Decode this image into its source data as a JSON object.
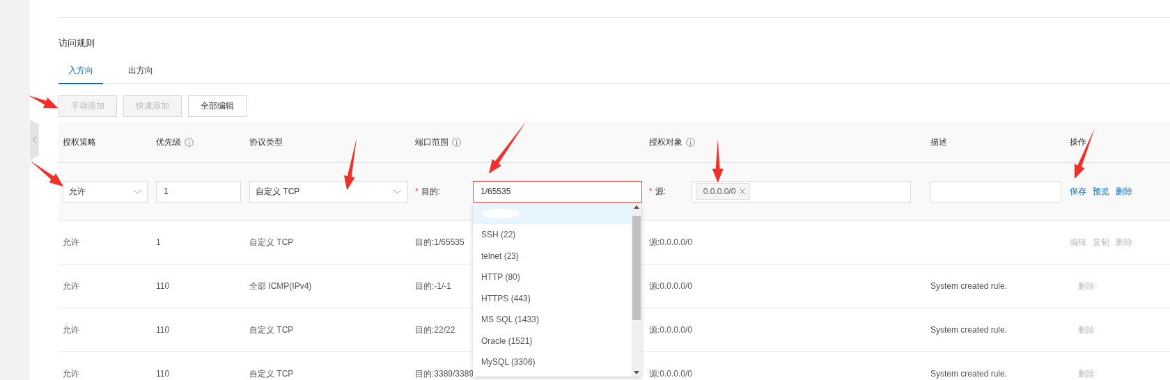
{
  "section_title": "访问规则",
  "tabs": [
    {
      "label": "入方向",
      "selected": true
    },
    {
      "label": "出方向",
      "selected": false
    }
  ],
  "toolbar": [
    {
      "label": "手动添加",
      "disabled": true
    },
    {
      "label": "快速添加",
      "disabled": true
    },
    {
      "label": "全部编辑",
      "disabled": false
    }
  ],
  "table": {
    "columns": [
      {
        "label": "授权策略",
        "info": false
      },
      {
        "label": "优先级",
        "info": true
      },
      {
        "label": "协议类型",
        "info": false
      },
      {
        "label": "端口范围",
        "info": true
      },
      {
        "label": "授权对象",
        "info": true
      },
      {
        "label": "描述",
        "info": false
      },
      {
        "label": "操作",
        "info": false
      }
    ],
    "edit_row": {
      "policy": "允许",
      "priority": "1",
      "protocol": "自定义 TCP",
      "required_mark": "*",
      "port_label": "目的:",
      "port_value": "1/65535",
      "invalid": true,
      "source_label": "源:",
      "source_tags": [
        "0.0.0.0/0"
      ],
      "actions": [
        {
          "label": "保存",
          "disabled": false
        },
        {
          "label": "预览",
          "disabled": false
        },
        {
          "label": "删除",
          "disabled": false
        }
      ]
    },
    "port_dropdown": [
      {
        "kind": "redacted",
        "selected": true
      },
      {
        "kind": "option",
        "label": "SSH (22)",
        "selected": false
      },
      {
        "kind": "option",
        "label": "telnet (23)",
        "selected": false
      },
      {
        "kind": "option",
        "label": "HTTP (80)",
        "selected": false
      },
      {
        "kind": "option",
        "label": "HTTPS (443)",
        "selected": false
      },
      {
        "kind": "option",
        "label": "MS SQL (1433)",
        "selected": false
      },
      {
        "kind": "option",
        "label": "Oracle (1521)",
        "selected": false
      },
      {
        "kind": "option",
        "label": "MySQL (3306)",
        "selected": false
      }
    ],
    "rows": [
      {
        "policy": "允许",
        "priority": "1",
        "protocol": "自定义 TCP",
        "port": "目的:1/65535",
        "source": "源:0.0.0.0/0",
        "actions": [
          {
            "label": "编辑",
            "disabled": true
          },
          {
            "label": "复制",
            "disabled": true
          },
          {
            "label": "删除",
            "disabled": true
          }
        ]
      },
      {
        "policy": "允许",
        "priority": "110",
        "protocol": "全部 ICMP(IPv4)",
        "port": "目的:-1/-1",
        "source": "源:0.0.0.0/0",
        "description": "System created rule.",
        "actions": [
          {
            "label": "删除",
            "disabled": true
          }
        ]
      },
      {
        "policy": "允许",
        "priority": "110",
        "protocol": "自定义 TCP",
        "port": "目的:22/22",
        "source": "源:0.0.0.0/0",
        "description": "System created rule.",
        "actions": [
          {
            "label": "删除",
            "disabled": true
          }
        ]
      },
      {
        "policy": "允许",
        "priority": "110",
        "protocol": "自定义 TCP",
        "port": "目的:3389/3389",
        "source": "源:0.0.0.0/0",
        "description": "System created rule.",
        "actions": [
          {
            "label": "删除",
            "disabled": true
          }
        ]
      }
    ]
  }
}
